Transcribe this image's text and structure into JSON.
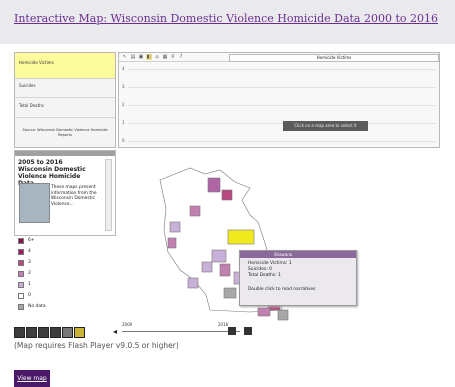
{
  "page": {
    "title": "Interactive Map: Wisconsin Domestic Violence Homicide Data 2000 to 2016"
  },
  "left_panel": {
    "items": [
      {
        "label": "Homicide Victims"
      },
      {
        "label": "Suicides"
      },
      {
        "label": "Total Deaths"
      }
    ],
    "source": "Source: Wisconsin Domestic Violence Homicide Reports"
  },
  "chart": {
    "title": "Homicide Victims",
    "y_ticks": [
      "4",
      "3",
      "2",
      "1",
      "0"
    ],
    "tooltip": "Click on a map area to select it",
    "toolbar_icons": [
      "pointer-icon",
      "print-icon",
      "copy-icon",
      "zoom-in-icon",
      "zoom-out-icon",
      "table-icon",
      "search-icon",
      "help-icon"
    ]
  },
  "info_panel": {
    "title": "2005 to 2016 Wisconsin Domestic Violence Homicide Data",
    "text": "These maps present information from the Wisconsin Domestic Violence..."
  },
  "legend": {
    "items": [
      {
        "label": "6+",
        "color": "#8b1250"
      },
      {
        "label": "4",
        "color": "#a0185e"
      },
      {
        "label": "3",
        "color": "#b8497f"
      },
      {
        "label": "2",
        "color": "#c080b0"
      },
      {
        "label": "1",
        "color": "#c8b0d8"
      },
      {
        "label": "0",
        "color": "#ffffff"
      },
      {
        "label": "No data",
        "color": "#a8a8a8"
      }
    ]
  },
  "popup": {
    "header": "Shawano",
    "lines": [
      "Homicide Victims: 1",
      "Suicides: 0",
      "Total Deaths: 1",
      "Double click to read narratives"
    ]
  },
  "slider": {
    "start_label": "2000",
    "end_label": "2016"
  },
  "note": "(Map requires Flash Player v9.0.5 or higher)",
  "view_button": "View map"
}
